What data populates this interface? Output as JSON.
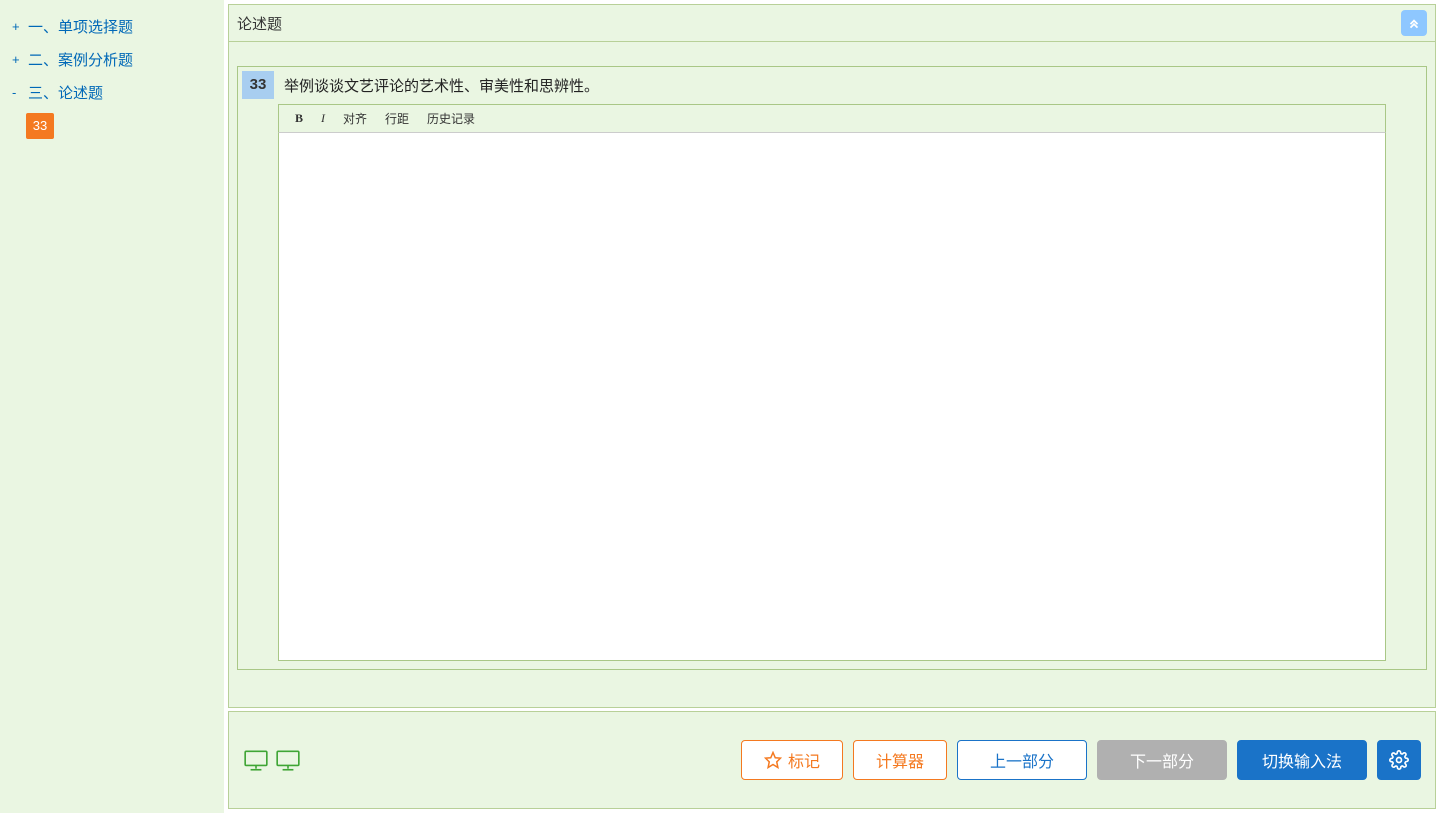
{
  "sidebar": {
    "sections": [
      {
        "toggle": "+",
        "label": "一、单项选择题"
      },
      {
        "toggle": "+",
        "label": "二、案例分析题"
      },
      {
        "toggle": "-",
        "label": "三、论述题"
      }
    ],
    "currentQuestionNum": "33"
  },
  "header": {
    "title": "论述题"
  },
  "question": {
    "number": "33",
    "text": "举例谈谈文艺评论的艺术性、审美性和思辨性。"
  },
  "editor": {
    "toolbar": {
      "bold": "B",
      "italic": "I",
      "align": "对齐",
      "linespace": "行距",
      "history": "历史记录"
    }
  },
  "footer": {
    "mark": "标记",
    "calculator": "计算器",
    "prev": "上一部分",
    "next": "下一部分",
    "ime": "切换输入法"
  }
}
